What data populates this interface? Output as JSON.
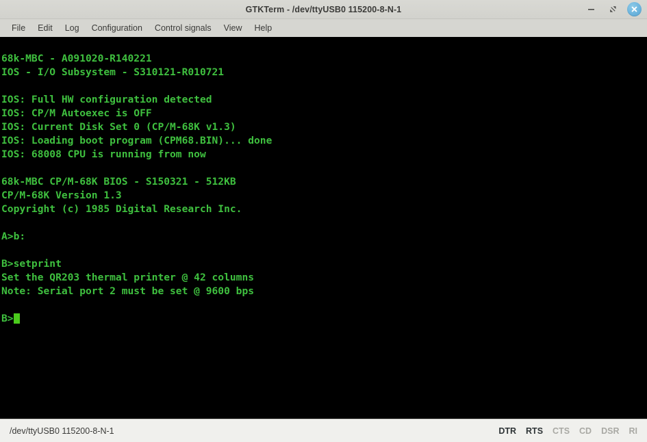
{
  "window": {
    "title": "GTKTerm - /dev/ttyUSB0  115200-8-N-1",
    "buttons": {
      "minimize": "minimize",
      "maximize": "maximize",
      "close": "close"
    }
  },
  "menubar": {
    "items": [
      {
        "label": "File"
      },
      {
        "label": "Edit"
      },
      {
        "label": "Log"
      },
      {
        "label": "Configuration"
      },
      {
        "label": "Control signals"
      },
      {
        "label": "View"
      },
      {
        "label": "Help"
      }
    ]
  },
  "terminal": {
    "foreground_color": "#3fc03f",
    "background_color": "#000000",
    "cursor_color": "#4bcb1c",
    "lines": [
      "",
      "68k-MBC - A091020-R140221",
      "IOS - I/O Subsystem - S310121-R010721",
      "",
      "IOS: Full HW configuration detected",
      "IOS: CP/M Autoexec is OFF",
      "IOS: Current Disk Set 0 (CP/M-68K v1.3)",
      "IOS: Loading boot program (CPM68.BIN)... done",
      "IOS: 68008 CPU is running from now",
      "",
      "68k-MBC CP/M-68K BIOS - S150321 - 512KB",
      "CP/M-68K Version 1.3",
      "Copyright (c) 1985 Digital Research Inc.",
      "",
      "A>b:",
      "",
      "B>setprint",
      "Set the QR203 thermal printer @ 42 columns",
      "Note: Serial port 2 must be set @ 9600 bps",
      ""
    ],
    "prompt": "B>"
  },
  "statusbar": {
    "port_info": "/dev/ttyUSB0  115200-8-N-1",
    "signals": [
      {
        "label": "DTR",
        "active": true
      },
      {
        "label": "RTS",
        "active": true
      },
      {
        "label": "CTS",
        "active": false
      },
      {
        "label": "CD",
        "active": false
      },
      {
        "label": "DSR",
        "active": false
      },
      {
        "label": "RI",
        "active": false
      }
    ],
    "active_color": "#2e3436",
    "inactive_color": "#a9a9a4"
  }
}
